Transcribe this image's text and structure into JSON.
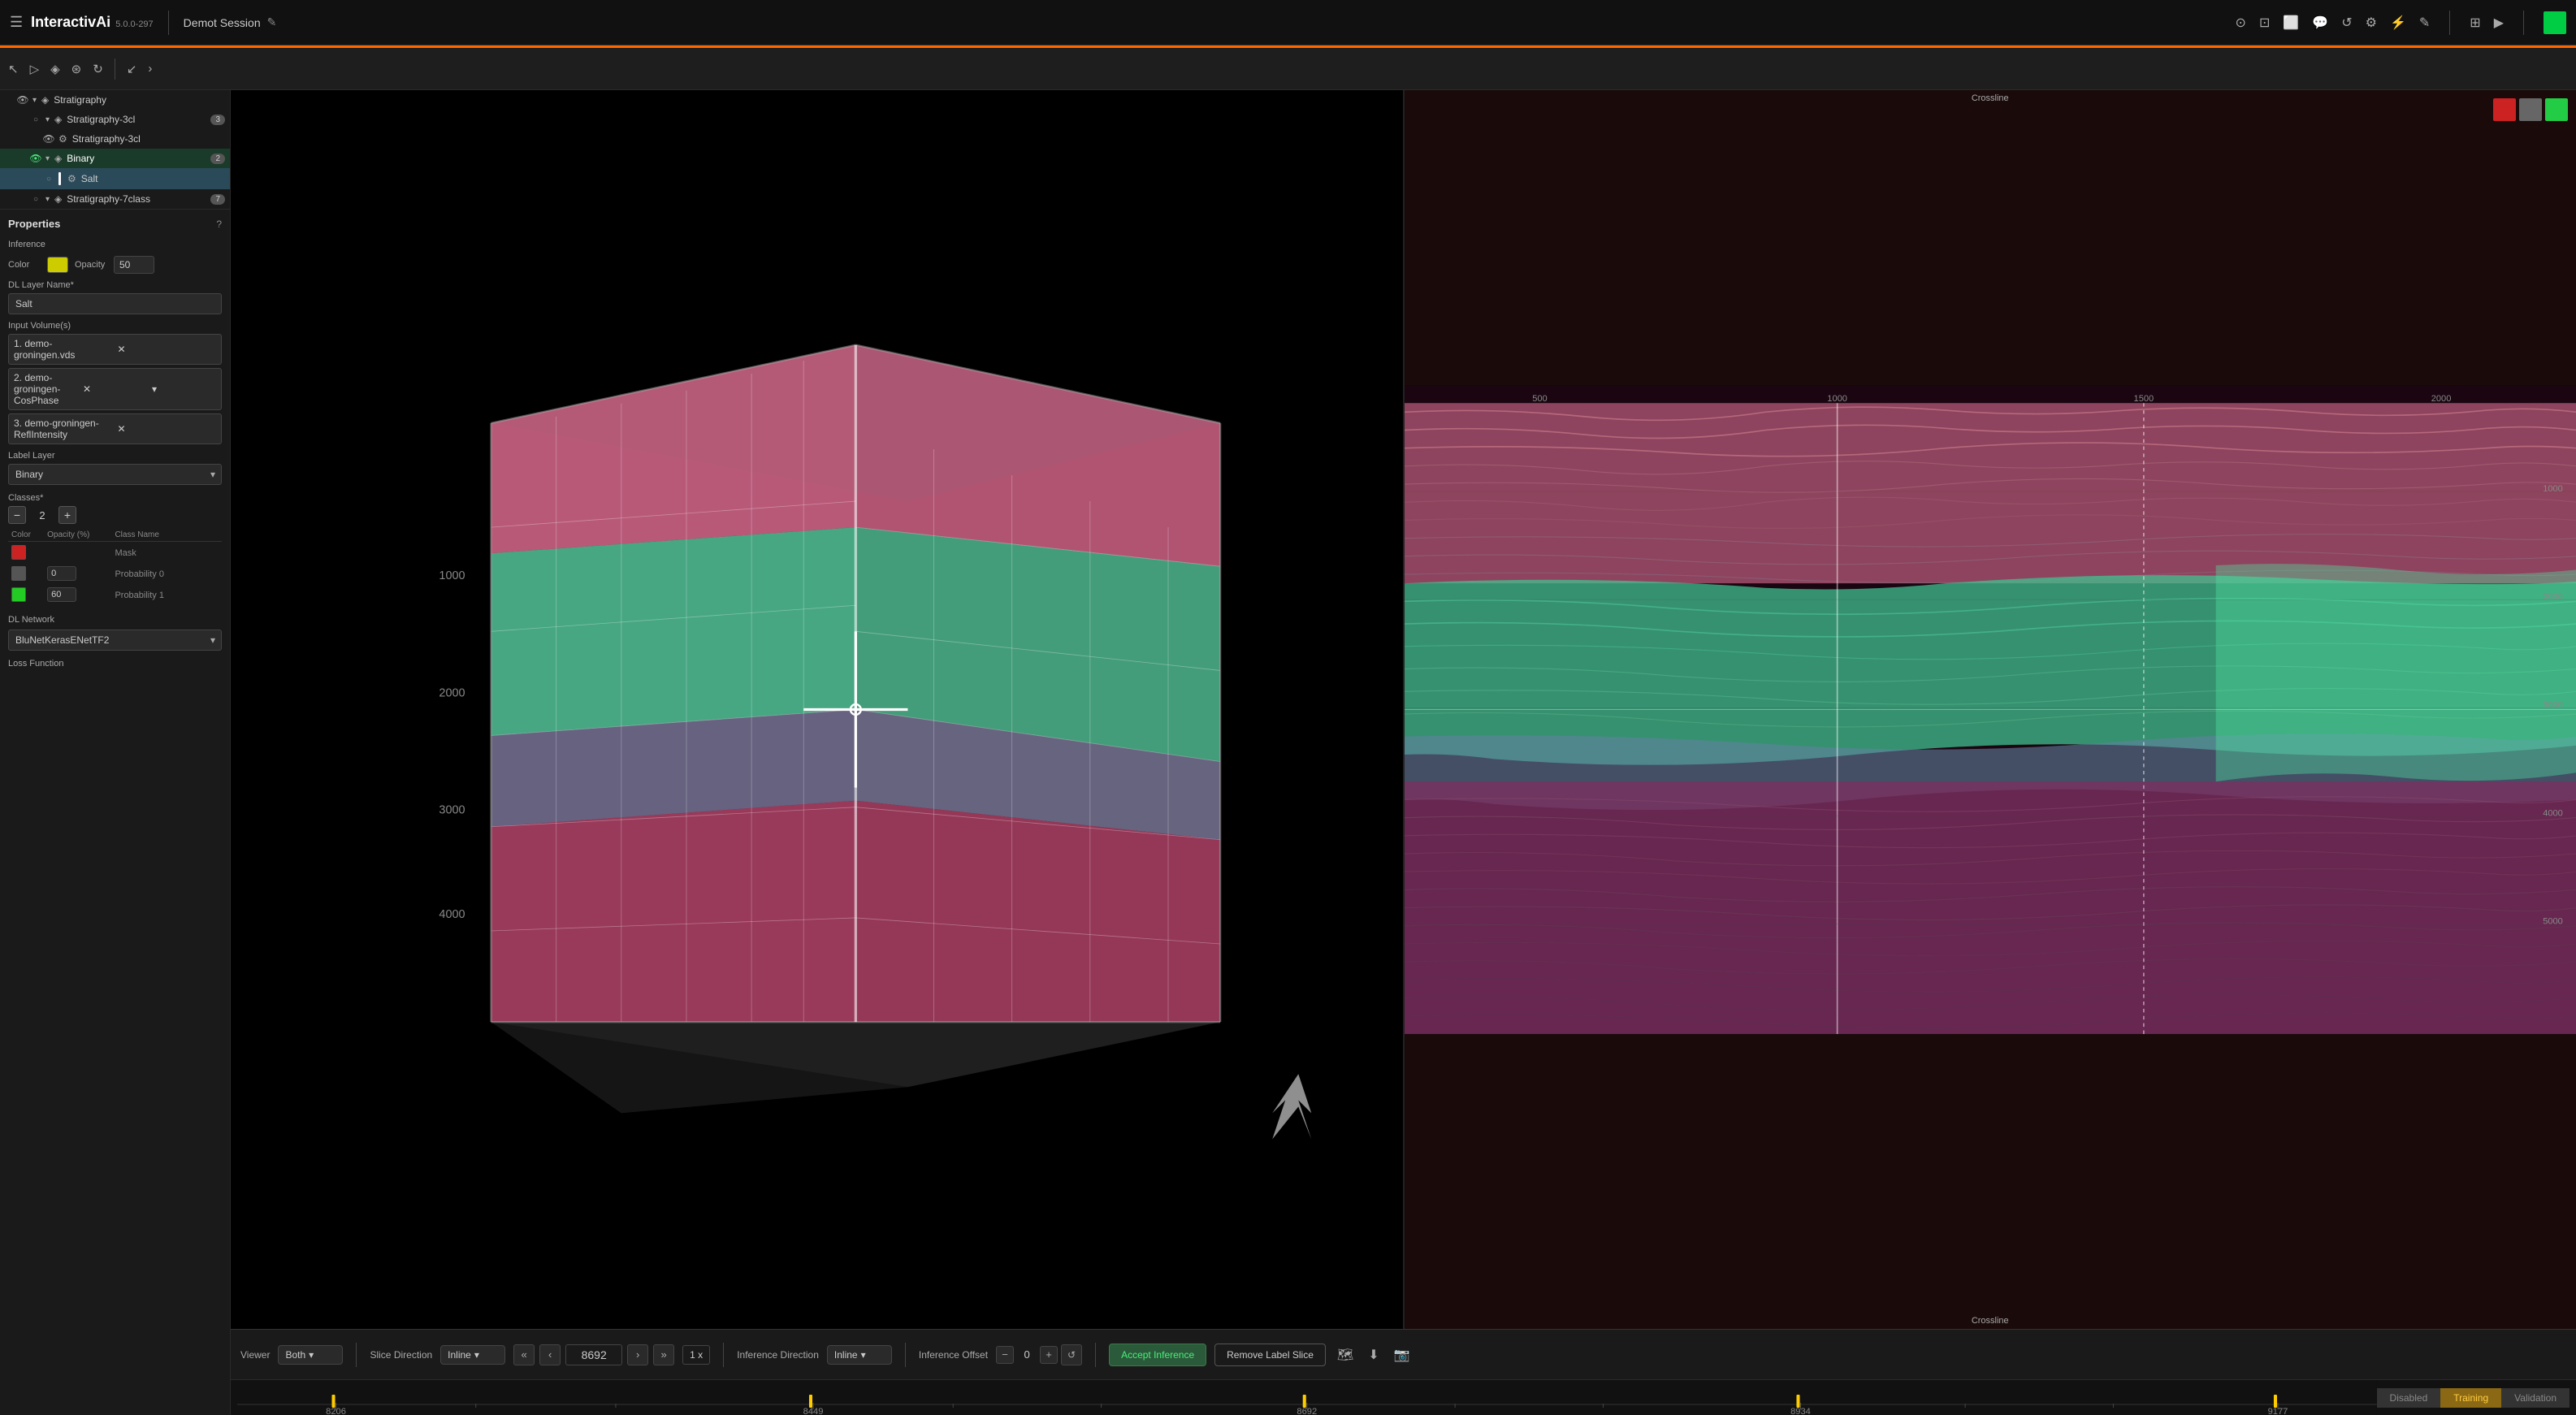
{
  "app": {
    "name": "InteractivAi",
    "version": "5.0.0-297",
    "session": "Demot Session"
  },
  "topbar": {
    "menu_icon": "☰",
    "edit_icon": "✎",
    "tools": [
      "⊙",
      "⊡",
      "⬜",
      "💬",
      "↺",
      "⚙",
      "⚡",
      "✎",
      "⊞",
      "▶"
    ],
    "color_dot_color": "#00cc44"
  },
  "toolbar2": {
    "buttons": [
      "↖",
      "▷",
      "◈",
      "⊛",
      "↻",
      "↙"
    ]
  },
  "layer_tree": {
    "items": [
      {
        "id": "stratigraphy",
        "label": "Stratigraphy",
        "level": 1,
        "has_eye": true,
        "has_arrow": true,
        "icon": "◈",
        "badge": ""
      },
      {
        "id": "stratigraphy-3cl",
        "label": "Stratigraphy-3cl",
        "level": 2,
        "has_eye": false,
        "has_arrow": true,
        "icon": "◈",
        "badge": "3"
      },
      {
        "id": "stratigraphy-3cl-child",
        "label": "Stratigraphy-3cl",
        "level": 3,
        "has_eye": true,
        "has_arrow": false,
        "icon": "⚙",
        "badge": ""
      },
      {
        "id": "binary",
        "label": "Binary",
        "level": 2,
        "has_eye": true,
        "has_arrow": true,
        "icon": "◈",
        "badge": "2",
        "selected": false,
        "highlighted": true
      },
      {
        "id": "salt",
        "label": "Salt",
        "level": 3,
        "has_eye": false,
        "has_arrow": false,
        "icon": "⚙",
        "badge": "",
        "active": true
      },
      {
        "id": "stratigraphy-7class",
        "label": "Stratigraphy-7class",
        "level": 2,
        "has_eye": false,
        "has_arrow": true,
        "icon": "◈",
        "badge": "7"
      }
    ]
  },
  "properties": {
    "title": "Properties",
    "help_icon": "?",
    "inference_label": "Inference",
    "color_label": "Color",
    "color_value": "#cccc00",
    "opacity_label": "Opacity",
    "opacity_value": "50",
    "dl_layer_name_label": "DL Layer Name*",
    "dl_layer_name_value": "Salt",
    "input_volumes_label": "Input Volume(s)",
    "input_volumes": [
      {
        "value": "1. demo-groningen.vds"
      },
      {
        "value": "2. demo-groningen-CosPhase"
      },
      {
        "value": "3. demo-groningen-ReflIntensity"
      }
    ],
    "label_layer_label": "Label Layer",
    "label_layer_value": "Binary",
    "classes_label": "Classes*",
    "classes_count": "2",
    "classes_table_headers": [
      "Color",
      "Opacity (%)",
      "Class Name"
    ],
    "classes": [
      {
        "color": "#cc2222",
        "opacity": "",
        "name": "Mask"
      },
      {
        "color": "#555555",
        "opacity": "0",
        "name": "Probability 0"
      },
      {
        "color": "#22cc22",
        "opacity": "60",
        "name": "Probability 1"
      }
    ],
    "dl_network_label": "DL Network",
    "dl_network_value": "BluNetKerasENetTF2",
    "loss_function_label": "Loss Function"
  },
  "bottom_toolbar": {
    "viewer_label": "Viewer",
    "viewer_value": "Both",
    "slice_direction_label": "Slice Direction",
    "slice_direction_value": "Inline",
    "slice_number": "8692",
    "zoom_value": "1 x",
    "inference_direction_label": "Inference Direction",
    "inference_direction_value": "Inline",
    "inference_offset_label": "Inference Offset",
    "inference_offset_value": "0",
    "accept_btn": "Accept Inference",
    "remove_btn": "Remove Label Slice",
    "nav_prev_double": "«",
    "nav_prev": "‹",
    "nav_next": "›",
    "nav_next_double": "»",
    "reset_icon": "↺"
  },
  "status_pills": {
    "disabled": "Disabled",
    "training": "Training",
    "validation": "Validation"
  },
  "timeline": {
    "labels": [
      "8206",
      "8449",
      "8692",
      "8934",
      "9177"
    ],
    "marker_positions": [
      0,
      28,
      50,
      72,
      100
    ]
  },
  "viewer_2d": {
    "crossline_label": "Crossline",
    "colors": [
      "#cc2222",
      "#666666",
      "#22cc44"
    ],
    "y_labels": [
      "1000",
      "2000",
      "3000",
      "4000",
      "5000"
    ]
  },
  "colors": {
    "accent_orange": "#ff6600",
    "accent_teal": "#2a8a7a",
    "selected_bg": "#2a4a5a"
  }
}
